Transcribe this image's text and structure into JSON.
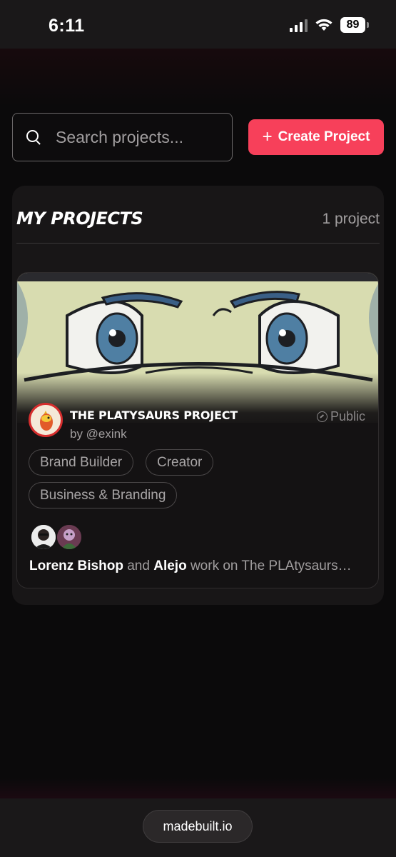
{
  "status_bar": {
    "time": "6:11",
    "battery": "89"
  },
  "search": {
    "placeholder": "Search projects...",
    "value": ""
  },
  "create_button": {
    "icon": "plus-icon",
    "label": "Create Project",
    "color": "#f7405a"
  },
  "my_projects": {
    "title": "MY PROJECTS",
    "count_label": "1 project",
    "items": [
      {
        "title": "THE PLATYSAURS PROJECT",
        "author": "by @exink",
        "visibility": "Public",
        "tags": [
          "Brand Builder",
          "Creator",
          "Business & Branding"
        ],
        "collaborators": [
          {
            "name": "Lorenz Bishop"
          },
          {
            "name": "Alejo"
          }
        ],
        "collab_joiner": " and ",
        "collab_suffix": " work on The PLAtysaurs…"
      }
    ]
  },
  "browser": {
    "url": "madebuilt.io"
  }
}
